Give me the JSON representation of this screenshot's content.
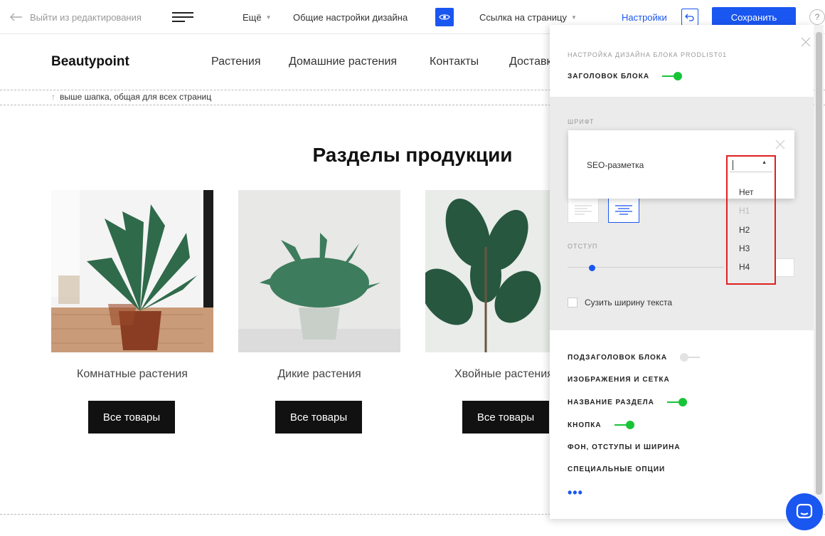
{
  "toolbar": {
    "exit_label": "Выйти из редактирования",
    "more_label": "Ещё",
    "design_label": "Общие настройки дизайна",
    "page_link_label": "Ссылка на страницу",
    "settings_label": "Настройки",
    "save_label": "Сохранить",
    "help_label": "?"
  },
  "site": {
    "brand": "Beautypoint",
    "nav": [
      "Растения",
      "Домашние растения",
      "Контакты",
      "Доставка"
    ],
    "header_note": "выше шапка, общая для всех страниц"
  },
  "content": {
    "title": "Разделы продукции",
    "cards": [
      {
        "name": "Комнатные растения",
        "button": "Все товары"
      },
      {
        "name": "Дикие растения",
        "button": "Все товары"
      },
      {
        "name": "Хвойные растения",
        "button": "Все товары"
      }
    ]
  },
  "panel": {
    "caption": "Настройка дизайна блока PRODLIST01",
    "block_title": "Заголовок блока",
    "font_caption": "Шрифт",
    "indent_caption": "Отступ",
    "narrow_text": "Сузить ширину текста",
    "sections": [
      {
        "label": "Подзаголовок блока",
        "toggle": "off"
      },
      {
        "label": "Изображения и сетка",
        "toggle": "none"
      },
      {
        "label": "Название раздела",
        "toggle": "on"
      },
      {
        "label": "Кнопка",
        "toggle": "on"
      },
      {
        "label": "Фон, отступы и ширина",
        "toggle": "none"
      },
      {
        "label": "Специальные опции",
        "toggle": "none"
      }
    ],
    "more": "•••"
  },
  "seo_popup": {
    "label": "SEO-разметка",
    "selected": "",
    "options": [
      {
        "label": "Нет",
        "disabled": false
      },
      {
        "label": "H1",
        "disabled": true
      },
      {
        "label": "H2",
        "disabled": false
      },
      {
        "label": "H3",
        "disabled": false
      },
      {
        "label": "H4",
        "disabled": false
      }
    ]
  },
  "colors": {
    "accent": "#1a56f0",
    "toggle_on": "#18c437",
    "highlight": "#e02020"
  }
}
